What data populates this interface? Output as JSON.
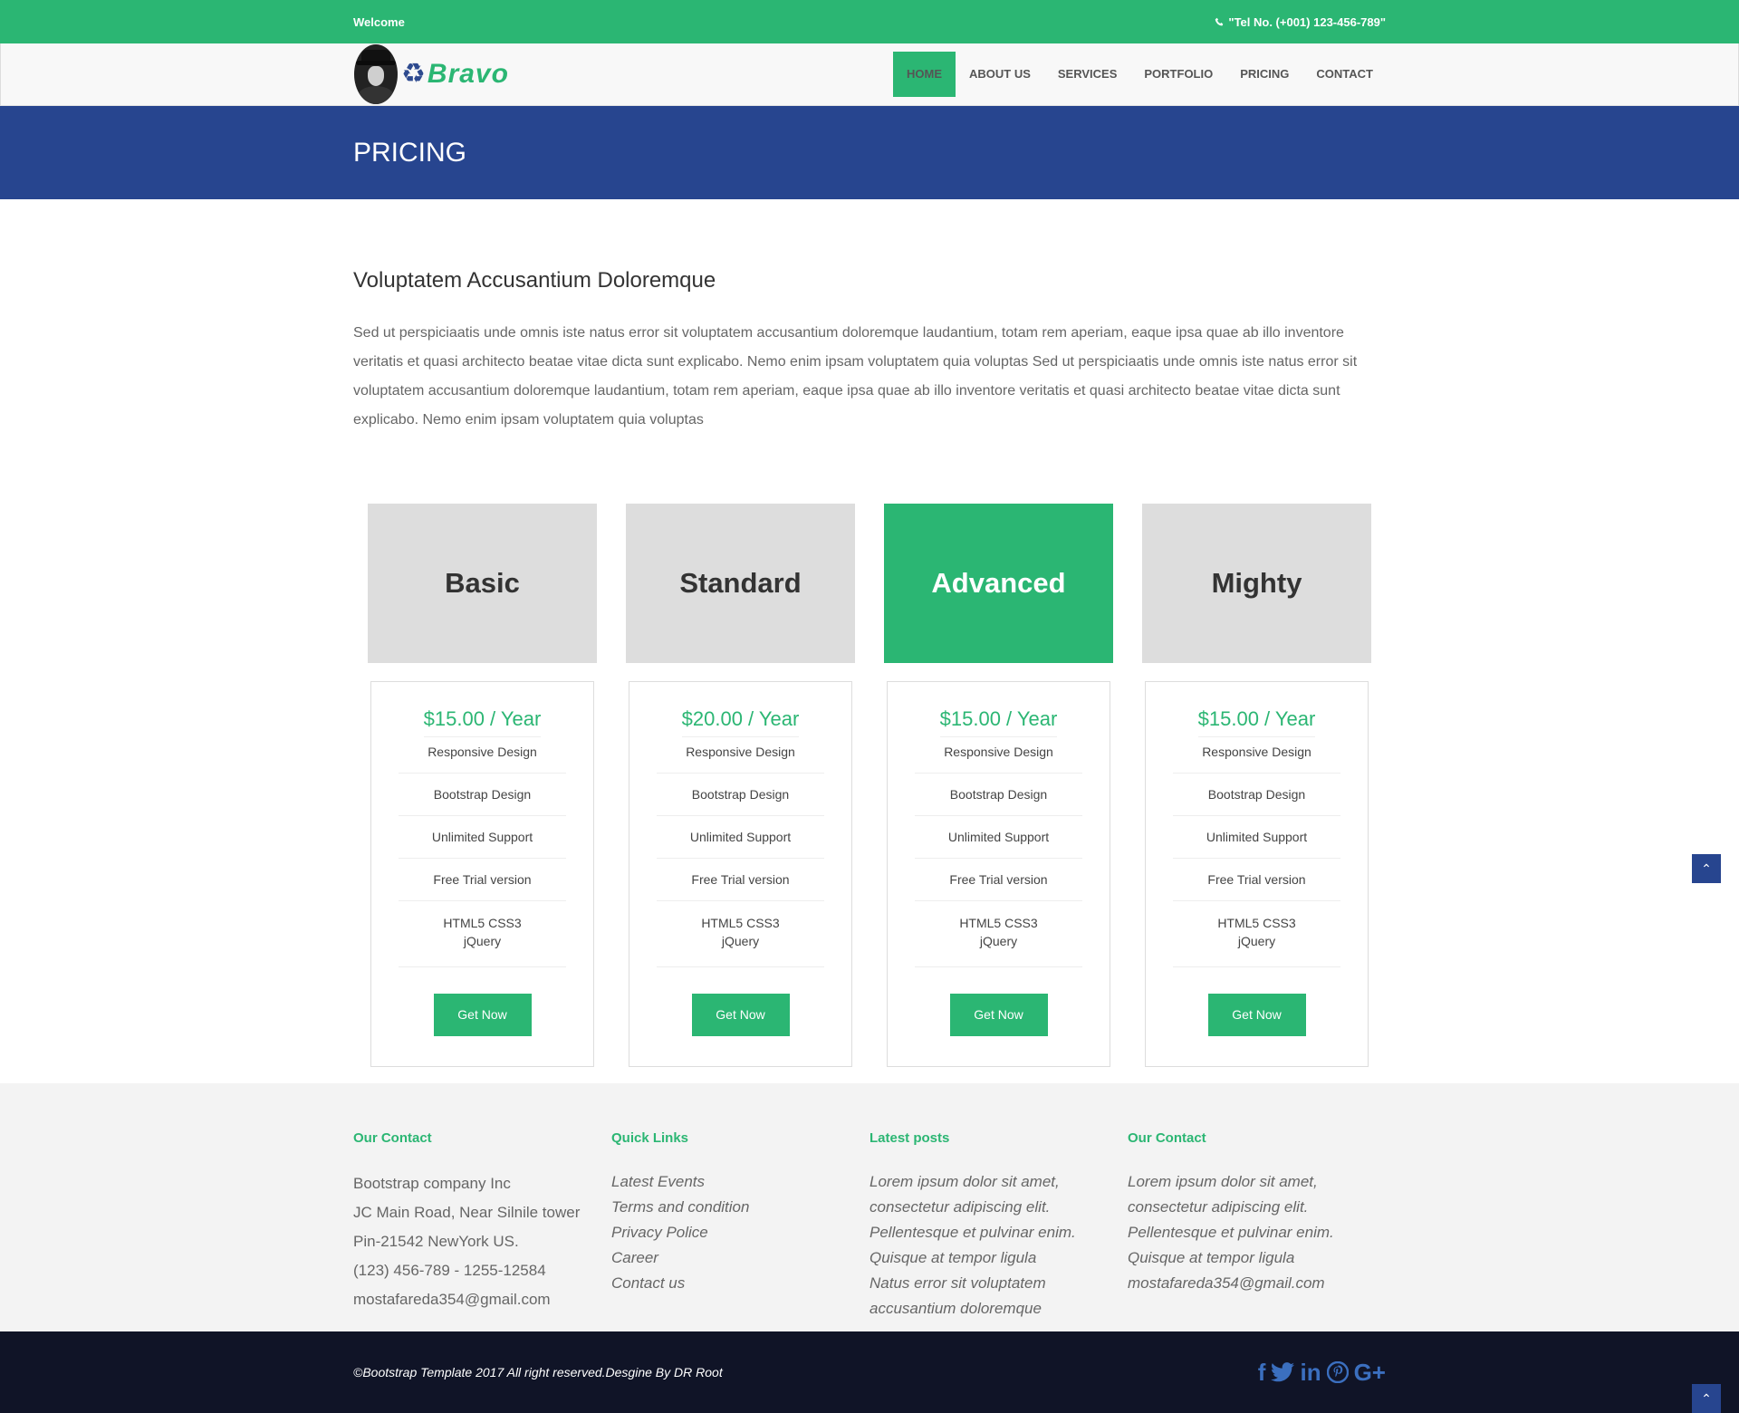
{
  "topbar": {
    "welcome": "Welcome",
    "tel": "\"Tel No. (+001) 123-456-789\"",
    "phone_icon": "phone-icon"
  },
  "header": {
    "brand": "Bravo",
    "nav": [
      "HOME",
      "ABOUT US",
      "SERVICES",
      "PORTFOLIO",
      "PRICING",
      "CONTACT"
    ],
    "active_nav": "HOME"
  },
  "page_title": "PRICING",
  "intro": {
    "heading": "Voluptatem Accusantium Doloremque",
    "body": "Sed ut perspiciaatis unde omnis iste natus error sit voluptatem accusantium doloremque laudantium, totam rem aperiam, eaque ipsa quae ab illo inventore veritatis et quasi architecto beatae vitae dicta sunt explicabo. Nemo enim ipsam voluptatem quia voluptas Sed ut perspiciaatis unde omnis iste natus error sit voluptatem accusantium doloremque laudantium, totam rem aperiam, eaque ipsa quae ab illo inventore veritatis et quasi architecto beatae vitae dicta sunt explicabo. Nemo enim ipsam voluptatem quia voluptas"
  },
  "plans": [
    {
      "name": "Basic",
      "price": "$15.00 / Year",
      "featured": false,
      "features": [
        "Responsive Design",
        "Bootstrap Design",
        "Unlimited Support",
        "Free Trial version",
        "HTML5 CSS3 jQuery"
      ],
      "button": "Get Now"
    },
    {
      "name": "Standard",
      "price": "$20.00 / Year",
      "featured": false,
      "features": [
        "Responsive Design",
        "Bootstrap Design",
        "Unlimited Support",
        "Free Trial version",
        "HTML5 CSS3 jQuery"
      ],
      "button": "Get Now"
    },
    {
      "name": "Advanced",
      "price": "$15.00 / Year",
      "featured": true,
      "features": [
        "Responsive Design",
        "Bootstrap Design",
        "Unlimited Support",
        "Free Trial version",
        "HTML5 CSS3 jQuery"
      ],
      "button": "Get Now"
    },
    {
      "name": "Mighty",
      "price": "$15.00 / Year",
      "featured": false,
      "features": [
        "Responsive Design",
        "Bootstrap Design",
        "Unlimited Support",
        "Free Trial version",
        "HTML5 CSS3 jQuery"
      ],
      "button": "Get Now"
    }
  ],
  "footer": {
    "col1": {
      "title": "Our Contact",
      "lines": [
        "Bootstrap company Inc",
        "JC Main Road, Near Silnile tower",
        "Pin-21542 NewYork US.",
        "(123) 456-789 - 1255-12584",
        "mostafareda354@gmail.com"
      ]
    },
    "col2": {
      "title": "Quick Links",
      "links": [
        "Latest Events",
        "Terms and condition",
        "Privacy Police",
        "Career",
        "Contact us"
      ]
    },
    "col3": {
      "title": "Latest posts",
      "lines": [
        "Lorem ipsum dolor sit amet,",
        "consectetur adipiscing elit.",
        "Pellentesque et pulvinar enim.",
        "Quisque at tempor ligula",
        "Natus error sit voluptatem",
        "accusantium doloremque"
      ]
    },
    "col4": {
      "title": "Our Contact",
      "lines": [
        "Lorem ipsum dolor sit amet,",
        "consectetur adipiscing elit.",
        "Pellentesque et pulvinar enim.",
        "Quisque at tempor ligula",
        "mostafareda354@gmail.com"
      ]
    }
  },
  "bottombar": {
    "copyright": "©Bootstrap Template 2017 All right reserved.Desgine By DR Root",
    "social_icons": [
      "facebook-icon",
      "twitter-icon",
      "linkedin-icon",
      "pinterest-icon",
      "google-plus-icon"
    ]
  },
  "colors": {
    "green": "#2bb673",
    "blue": "#27458f",
    "dark": "#101427"
  }
}
